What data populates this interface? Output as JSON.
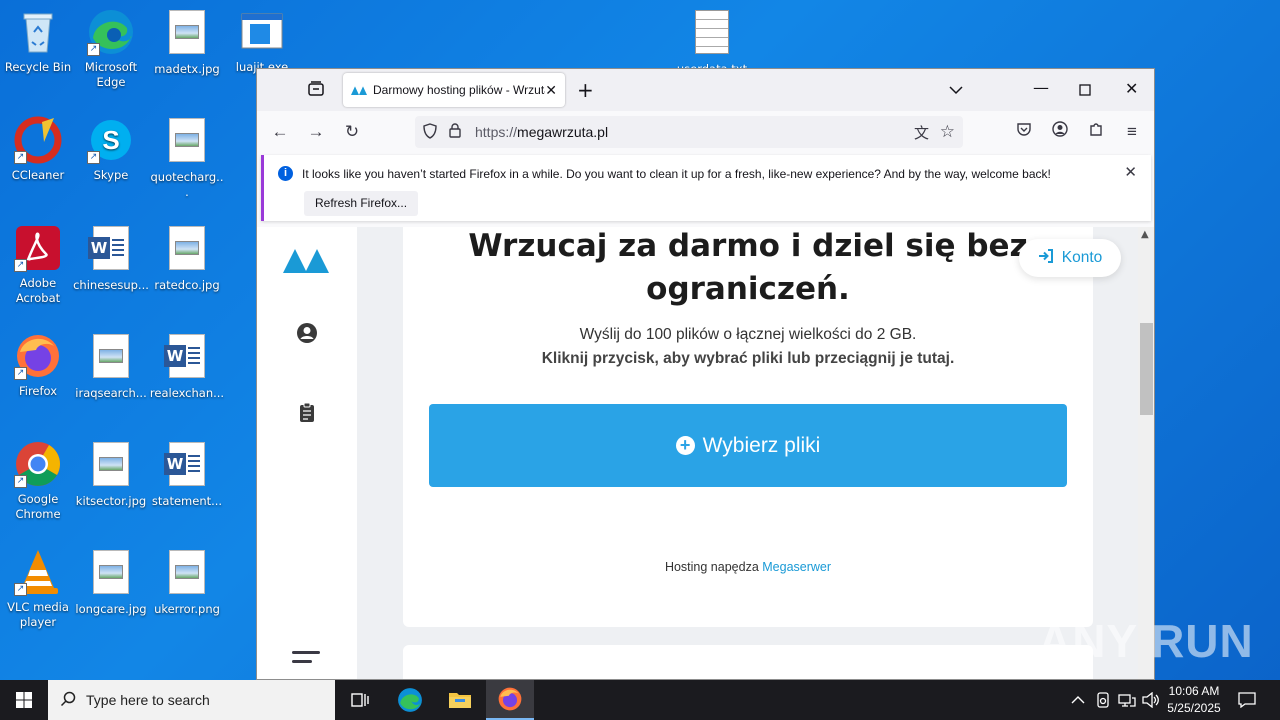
{
  "desktop": {
    "icons": [
      {
        "label": "Recycle Bin"
      },
      {
        "label": "Microsoft Edge"
      },
      {
        "label": "madetx.jpg"
      },
      {
        "label": "luajit.exe"
      },
      {
        "label": "userdata.txt"
      },
      {
        "label": "CCleaner"
      },
      {
        "label": "Skype"
      },
      {
        "label": "quotecharg..."
      },
      {
        "label": "Adobe Acrobat"
      },
      {
        "label": "chinesesup..."
      },
      {
        "label": "ratedco.jpg"
      },
      {
        "label": "Firefox"
      },
      {
        "label": "iraqsearch..."
      },
      {
        "label": "realexchan..."
      },
      {
        "label": "Google Chrome"
      },
      {
        "label": "kitsector.jpg"
      },
      {
        "label": "statement..."
      },
      {
        "label": "VLC media player"
      },
      {
        "label": "longcare.jpg"
      },
      {
        "label": "ukerror.png"
      }
    ]
  },
  "browser": {
    "tab_title": "Darmowy hosting plików - Wrzuta",
    "url_proto": "https://",
    "url_host": "megawrzuta.pl",
    "notification": {
      "message": "It looks like you haven’t started Firefox in a while. Do you want to clean it up for a fresh, like-new experience? And by the way, welcome back!",
      "button": "Refresh Firefox..."
    }
  },
  "page": {
    "heading": "Wrzucaj za darmo i dziel się bez ograniczeń.",
    "sub_line1": "Wyślij do 100 plików o łącznej wielkości do 2 GB.",
    "sub_line2": "Kliknij przycisk, aby wybrać pliki lub przeciągnij je tutaj.",
    "upload_button": "Wybierz pliki",
    "account_button": "Konto",
    "powered_text": "Hosting napędza",
    "powered_link": "Megaserwer",
    "accent": "#2aa3e6"
  },
  "taskbar": {
    "search_placeholder": "Type here to search",
    "time": "10:06 AM",
    "date": "5/25/2025"
  },
  "watermark": "ANY RUN"
}
